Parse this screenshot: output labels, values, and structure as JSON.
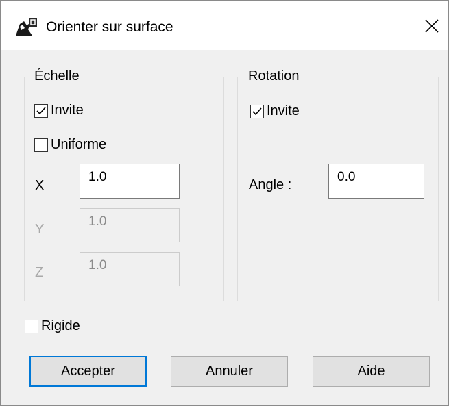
{
  "dialog": {
    "title": "Orienter sur surface",
    "close_icon": "close-icon",
    "app_icon": "rhino-app-icon"
  },
  "scale_group": {
    "label": "Échelle",
    "prompt_label": "Invite",
    "prompt_checked": true,
    "uniform_label": "Uniforme",
    "uniform_checked": false,
    "x_label": "X",
    "x_value": "1.0",
    "y_label": "Y",
    "y_value": "1.0",
    "z_label": "Z",
    "z_value": "1.0"
  },
  "rotation_group": {
    "label": "Rotation",
    "prompt_label": "Invite",
    "prompt_checked": true,
    "angle_label": "Angle :",
    "angle_value": "0.0"
  },
  "rigid": {
    "label": "Rigide",
    "checked": false
  },
  "buttons": {
    "accept": "Accepter",
    "cancel": "Annuler",
    "help": "Aide"
  },
  "colors": {
    "dialog_bg": "#f0f0f0",
    "default_button_border": "#0078d7"
  }
}
